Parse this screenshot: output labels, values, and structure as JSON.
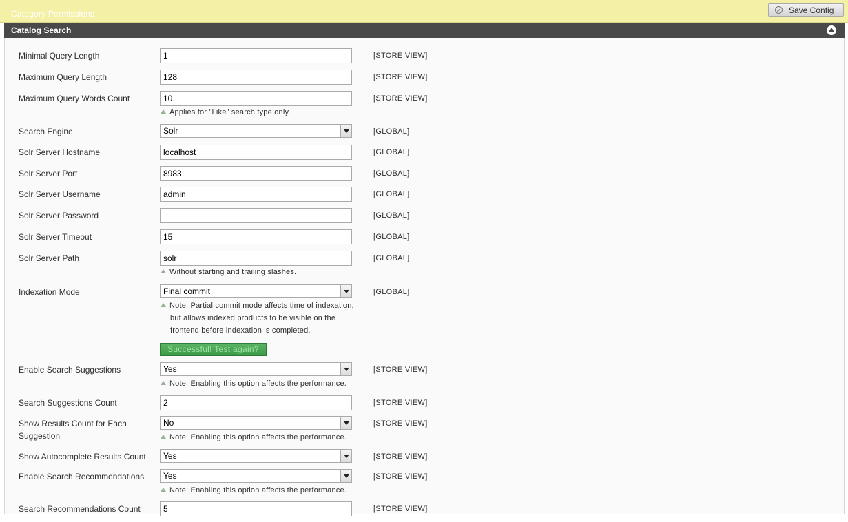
{
  "top_bar": {
    "faded_title": "Category Permissions",
    "save_label": "Save Config"
  },
  "section": {
    "title": "Catalog Search"
  },
  "fields": {
    "min_query_length": {
      "label": "Minimal Query Length",
      "value": "1",
      "scope": "[STORE VIEW]"
    },
    "max_query_length": {
      "label": "Maximum Query Length",
      "value": "128",
      "scope": "[STORE VIEW]"
    },
    "max_query_words": {
      "label": "Maximum Query Words Count",
      "value": "10",
      "scope": "[STORE VIEW]",
      "note": "Applies for \"Like\" search type only."
    },
    "search_engine": {
      "label": "Search Engine",
      "value": "Solr",
      "scope": "[GLOBAL]"
    },
    "solr_hostname": {
      "label": "Solr Server Hostname",
      "value": "localhost",
      "scope": "[GLOBAL]"
    },
    "solr_port": {
      "label": "Solr Server Port",
      "value": "8983",
      "scope": "[GLOBAL]"
    },
    "solr_username": {
      "label": "Solr Server Username",
      "value": "admin",
      "scope": "[GLOBAL]"
    },
    "solr_password": {
      "label": "Solr Server Password",
      "value": "",
      "scope": "[GLOBAL]"
    },
    "solr_timeout": {
      "label": "Solr Server Timeout",
      "value": "15",
      "scope": "[GLOBAL]"
    },
    "solr_path": {
      "label": "Solr Server Path",
      "value": "solr",
      "scope": "[GLOBAL]",
      "note": "Without starting and trailing slashes."
    },
    "indexation_mode": {
      "label": "Indexation Mode",
      "value": "Final commit",
      "scope": "[GLOBAL]",
      "note_lines": [
        "Note: Partial commit mode affects time of indexation,",
        "but allows indexed products to be visible on the",
        "frontend before indexation is completed."
      ],
      "test_button": "Successful! Test again?"
    },
    "enable_suggestions": {
      "label": "Enable Search Suggestions",
      "value": "Yes",
      "scope": "[STORE VIEW]",
      "note": "Note: Enabling this option affects the performance."
    },
    "suggestions_count": {
      "label": "Search Suggestions Count",
      "value": "2",
      "scope": "[STORE VIEW]"
    },
    "show_results_count": {
      "label_line1": "Show Results Count for Each",
      "label_line2": "Suggestion",
      "value": "No",
      "scope": "[STORE VIEW]",
      "note": "Note: Enabling this option affects the performance."
    },
    "autocomplete_count": {
      "label": "Show Autocomplete Results Count",
      "value": "Yes",
      "scope": "[STORE VIEW]"
    },
    "enable_recommendations": {
      "label": "Enable Search Recommendations",
      "value": "Yes",
      "scope": "[STORE VIEW]",
      "note": "Note: Enabling this option affects the performance."
    },
    "recommendations_count": {
      "label": "Search Recommendations Count",
      "value": "5",
      "scope": "[STORE VIEW]"
    }
  },
  "icons": {
    "collapse": "chevron-up-circle-icon",
    "note": "triangle-up-icon",
    "save": "check-circle-icon"
  }
}
